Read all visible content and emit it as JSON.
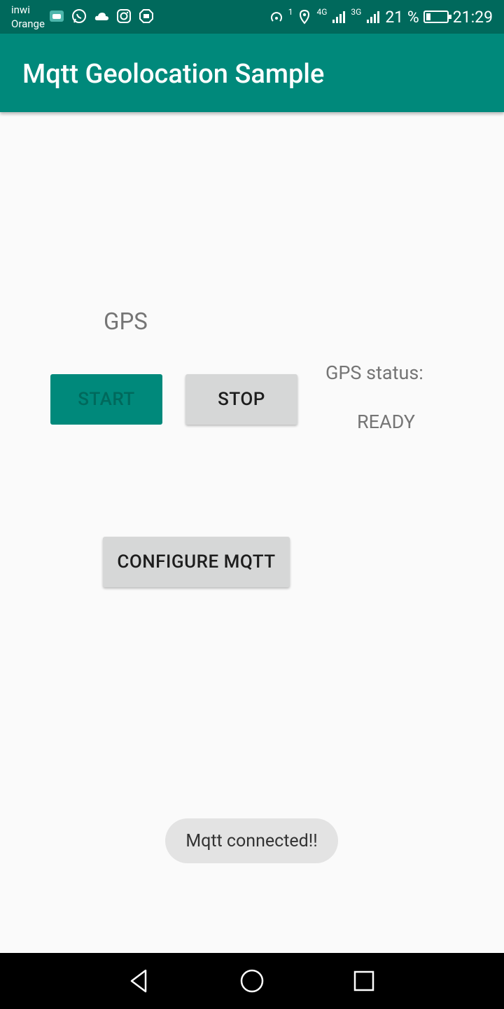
{
  "status_bar": {
    "carrier_line1": "inwi",
    "carrier_line2": "Orange",
    "signal_sup": "1",
    "network_4g": "4G",
    "network_3g": "3G",
    "battery_percent": "21 %",
    "battery_level": 0.21,
    "time": "21:29",
    "notification_icons": [
      "android-icon",
      "whatsapp-icon",
      "cloud-icon",
      "instagram-icon",
      "shield-icon"
    ],
    "status_icons": [
      "hotspot-icon",
      "location-icon",
      "signal-icon",
      "signal-icon",
      "battery-icon"
    ]
  },
  "app_bar": {
    "title": "Mqtt Geolocation Sample"
  },
  "main": {
    "gps_label": "GPS",
    "start_button": "START",
    "stop_button": "STOP",
    "gps_status_label": "GPS status:",
    "gps_status_value": "READY",
    "configure_button": "CONFIGURE MQTT"
  },
  "toast": {
    "message": "Mqtt connected!!"
  },
  "colors": {
    "primary": "#00897b",
    "primary_dark": "#00695c",
    "button_grey": "#d6d7d7",
    "background": "#fafafa"
  },
  "nav_bar": {
    "buttons": [
      "back-icon",
      "home-icon",
      "recents-icon"
    ]
  }
}
